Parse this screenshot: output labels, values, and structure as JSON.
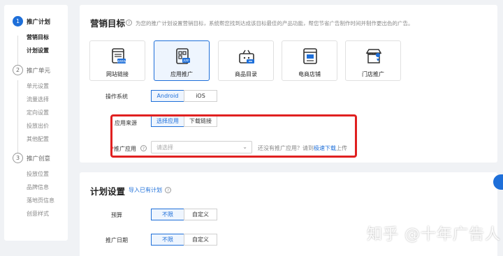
{
  "sidebar": {
    "steps": [
      {
        "num": "1",
        "title": "推广计划",
        "subs": [
          "营销目标",
          "计划设置"
        ]
      },
      {
        "num": "2",
        "title": "推广单元",
        "subs": [
          "单元设置",
          "流量选择",
          "定向设置",
          "投放出价",
          "其他配置"
        ]
      },
      {
        "num": "3",
        "title": "推广创意",
        "subs": [
          "投放位置",
          "品牌信息",
          "落地页信息",
          "创意样式"
        ]
      }
    ]
  },
  "marketing": {
    "title": "营销目标",
    "hint": "为您的推广计划设置营销目标，系统帮您找到达成该目标最佳的产品功能，帮您节省广告制作时间并制作更出色的广告。",
    "cards": [
      {
        "label": "网站链接",
        "icon": "website-www-icon"
      },
      {
        "label": "应用推广",
        "icon": "app-icon"
      },
      {
        "label": "商品目录",
        "icon": "shopping-basket-icon"
      },
      {
        "label": "电商店铺",
        "icon": "storefront-icon"
      },
      {
        "label": "门店推广",
        "icon": "shop-location-icon"
      }
    ],
    "os_label": "操作系统",
    "os_android": "Android",
    "os_ios": "iOS",
    "source_label": "应用来源",
    "source_select": "选择应用",
    "source_download": "下载链接",
    "app_required": "*",
    "app_label": "推广应用",
    "app_placeholder": "请选择",
    "app_hint_prefix": "还没有推广应用？请到",
    "app_hint_link": "极速下载",
    "app_hint_suffix": "上传"
  },
  "plan": {
    "title": "计划设置",
    "import_link": "导入已有计划",
    "budget_label": "预算",
    "budget_unlimited": "不限",
    "budget_custom": "自定义",
    "date_label": "推广日期",
    "date_unlimited": "不限",
    "date_custom": "自定义"
  },
  "watermark": "知乎 @十年广告人",
  "colors": {
    "accent": "#1e6fd9",
    "highlight": "#e02020"
  }
}
